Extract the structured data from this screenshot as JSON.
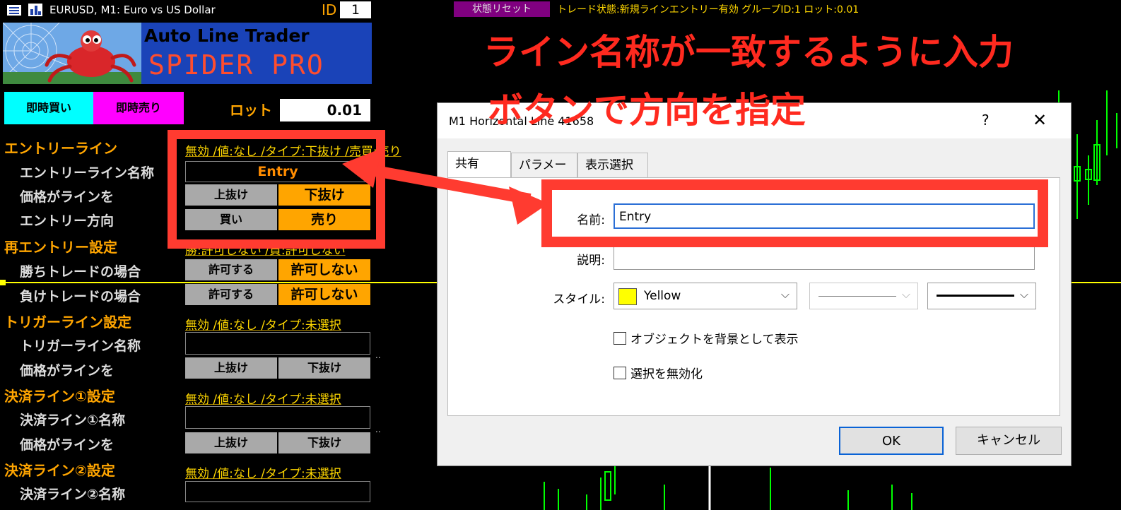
{
  "header": {
    "window_title": "EURUSD, M1:  Euro vs US Dollar",
    "id_label": "ID",
    "id_value": "1",
    "status_reset_label": "状態リセット",
    "status_text": "トレード状態:新規ラインエントリー有効 グループID:1  ロット:0.01"
  },
  "logo": {
    "line1": "Auto Line Trader",
    "line2": "SPIDER PRO"
  },
  "panel": {
    "buy_now": "即時買い",
    "sell_now": "即時売り",
    "lot_label": "ロット",
    "lot_value": "0.01",
    "entry_section": "エントリーライン",
    "entry_info": "無効 /値:なし /タイプ:下抜け /売買:売り",
    "entry_name_label": "エントリーライン名称",
    "entry_name_value": "Entry",
    "price_cross_label": "価格がラインを",
    "cross_up": "上抜け",
    "cross_down": "下抜け",
    "entry_direction_label": "エントリー方向",
    "buy": "買い",
    "sell": "売り",
    "reentry_section": "再エントリー設定",
    "reentry_info": "勝:許可しない /負:許可しない",
    "win_label": "勝ちトレードの場合",
    "lose_label": "負けトレードの場合",
    "allow": "許可する",
    "deny": "許可しない",
    "trigger_section": "トリガーライン設定",
    "trigger_info": "無効 /値:なし /タイプ:未選択",
    "trigger_name_label": "トリガーライン名称",
    "settle1_section": "決済ライン①設定",
    "settle1_info": "無効 /値:なし /タイプ:未選択",
    "settle1_name_label": "決済ライン①名称",
    "settle2_section": "決済ライン②設定",
    "settle2_info": "無効 /値:なし /タイプ:未選択",
    "settle2_name_label": "決済ライン②名称",
    "ellipsis": ".."
  },
  "annotation": {
    "line1": "ライン名称が一致するように入力",
    "line2": "ボタンで方向を指定"
  },
  "dialog": {
    "title": "M1 Horizontal Line 41658",
    "help": "?",
    "close": "✕",
    "tabs": [
      "共有",
      "パラメータ",
      "表示選択"
    ],
    "name_label": "名前:",
    "name_value": "Entry",
    "desc_label": "説明:",
    "desc_value": "",
    "style_label": "スタイル:",
    "color_value": "Yellow",
    "checkbox_background": "オブジェクトを背景として表示",
    "checkbox_disable_select": "選択を無効化",
    "ok": "OK",
    "cancel": "キャンセル"
  },
  "colors": {
    "accent_orange": "#ffa500",
    "highlight_red": "#ff3b30",
    "level_line": "#ffff00",
    "candle_green": "#00ff00"
  }
}
